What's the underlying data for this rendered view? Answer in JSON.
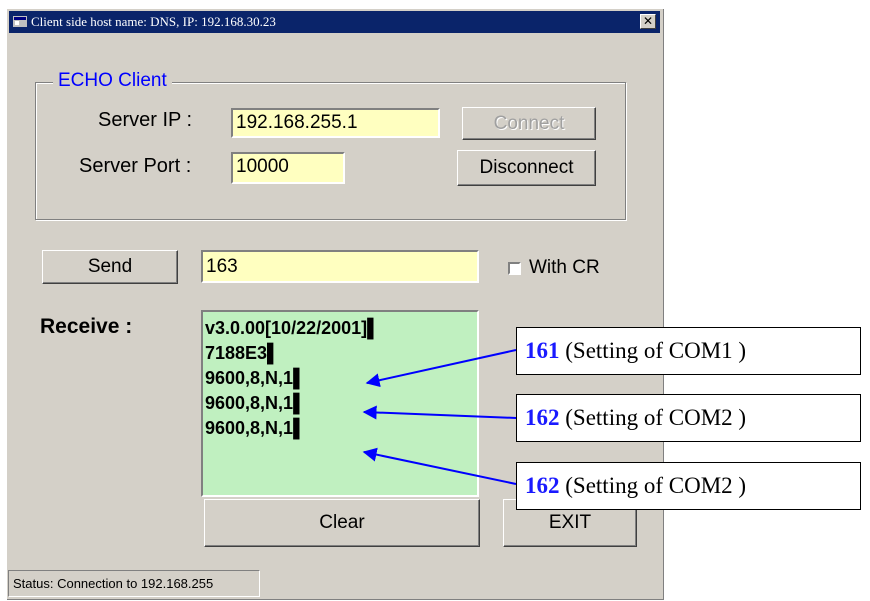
{
  "window": {
    "title": "Client side host name: DNS,   IP: 192.168.30.23",
    "close_glyph": "✕"
  },
  "group": {
    "legend": "ECHO  Client"
  },
  "server_ip": {
    "label": "Server IP :",
    "value": "192.168.255.1"
  },
  "server_port": {
    "label": "Server Port :",
    "value": "10000"
  },
  "connect_button": "Connect",
  "disconnect_button": "Disconnect",
  "send_button": "Send",
  "send_input": "163",
  "with_cr": {
    "label": "With CR",
    "checked": false
  },
  "receive": {
    "label": "Receive :",
    "lines": [
      "v3.0.00[10/22/2001]▌",
      "7188E3▌",
      "9600,8,N,1▌",
      "9600,8,N,1▌",
      "9600,8,N,1▌"
    ]
  },
  "clear_button": "Clear",
  "exit_button": "EXIT",
  "status_bar": "Status: Connection to 192.168.255",
  "callouts": [
    {
      "num": "161",
      "text": " (Setting of COM1 )"
    },
    {
      "num": "162",
      "text": " (Setting of COM2 )"
    },
    {
      "num": "162",
      "text": " (Setting of COM2 )"
    }
  ],
  "colors": {
    "title_bar": "#0a246a",
    "input_bg": "#ffffc0",
    "receive_bg": "#c0f0c0",
    "legend": "#0000ff",
    "callout_num": "#1a1aff",
    "arrow": "#0000ff"
  },
  "icons": [
    "app-icon",
    "close-icon",
    "checkbox",
    "arrow"
  ]
}
